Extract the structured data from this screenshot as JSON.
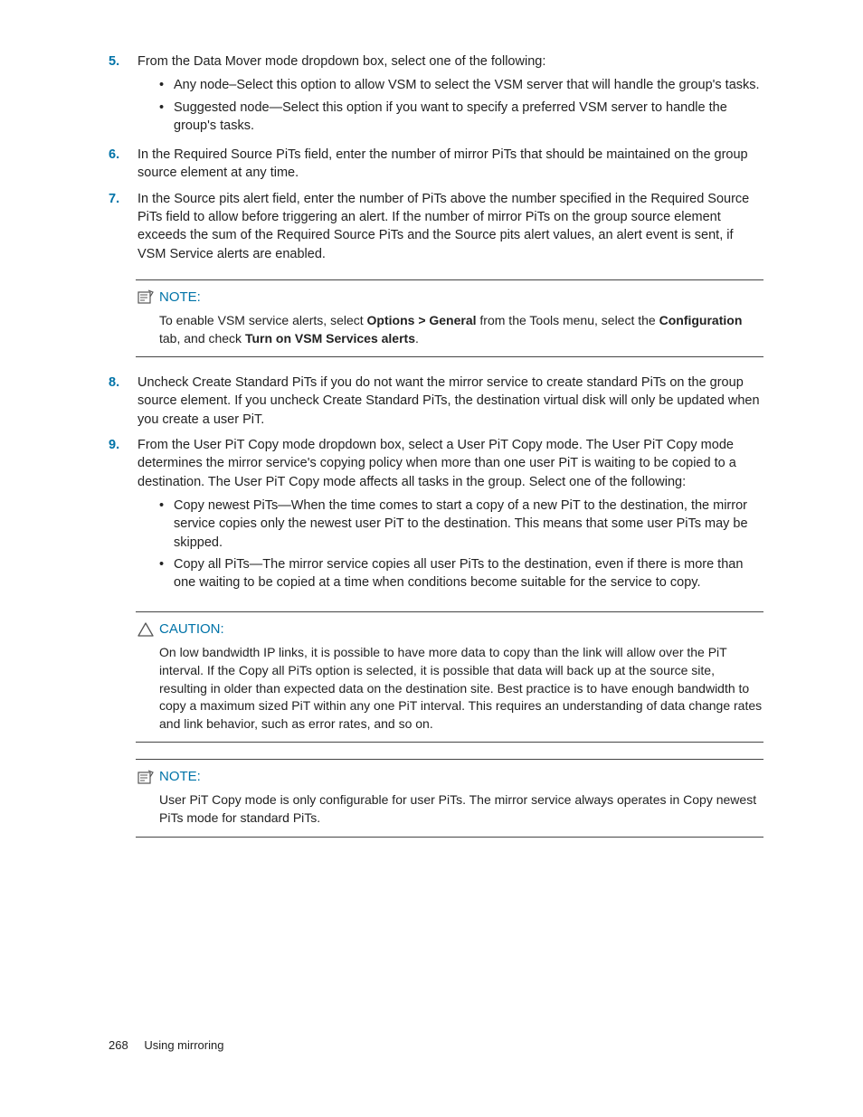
{
  "steps": {
    "s5": {
      "num": "5.",
      "text": "From the Data Mover mode dropdown box, select one of the following:",
      "bullets": [
        "Any node–Select this option to allow VSM to select the VSM server that will handle the group's tasks.",
        "Suggested node—Select this option if you want to specify a preferred VSM server to handle the group's tasks."
      ]
    },
    "s6": {
      "num": "6.",
      "text": "In the Required Source PiTs field, enter the number of mirror PiTs that should be maintained on the group source element at any time."
    },
    "s7": {
      "num": "7.",
      "text": "In the Source pits alert field, enter the number of PiTs above the number specified in the Required Source PiTs field to allow before triggering an alert. If the number of mirror PiTs on the group source element exceeds the sum of the Required Source PiTs and the Source pits alert values, an alert event is sent, if VSM Service alerts are enabled."
    },
    "s8": {
      "num": "8.",
      "text": "Uncheck Create Standard PiTs if you do not want the mirror service to create standard PiTs on the group source element. If you uncheck Create Standard PiTs, the destination virtual disk will only be updated when you create a user PiT."
    },
    "s9": {
      "num": "9.",
      "text": "From the User PiT Copy mode dropdown box, select a User PiT Copy mode. The User PiT Copy mode determines the mirror service's copying policy when more than one user PiT is waiting to be copied to a destination. The User PiT Copy mode affects all tasks in the group. Select one of the following:",
      "bullets": [
        "Copy newest PiTs—When the time comes to start a copy of a new PiT to the destination, the mirror service copies only the newest user PiT to the destination. This means that some user PiTs may be skipped.",
        "Copy all PiTs—The mirror service copies all user PiTs to the destination, even if there is more than one waiting to be copied at a time when conditions become suitable for the service to copy."
      ]
    }
  },
  "note1": {
    "label": "NOTE:",
    "pre": "To enable VSM service alerts, select ",
    "b1": "Options > General",
    "mid1": " from the Tools menu, select the ",
    "b2": "Configuration",
    "mid2": " tab, and check ",
    "b3": "Turn on VSM Services alerts",
    "post": "."
  },
  "caution": {
    "label": "CAUTION:",
    "text": "On low bandwidth IP links, it is possible to have more data to copy than the link will allow over the PiT interval. If the Copy all PiTs option is selected, it is possible that data will back up at the source site, resulting in older than expected data on the destination site. Best practice is to have enough bandwidth to copy a maximum sized PiT within any one PiT interval. This requires an understanding of data change rates and link behavior, such as error rates, and so on."
  },
  "note2": {
    "label": "NOTE:",
    "text": "User PiT Copy mode is only configurable for user PiTs. The mirror service always operates in Copy newest PiTs mode for standard PiTs."
  },
  "footer": {
    "page": "268",
    "section": "Using mirroring"
  }
}
